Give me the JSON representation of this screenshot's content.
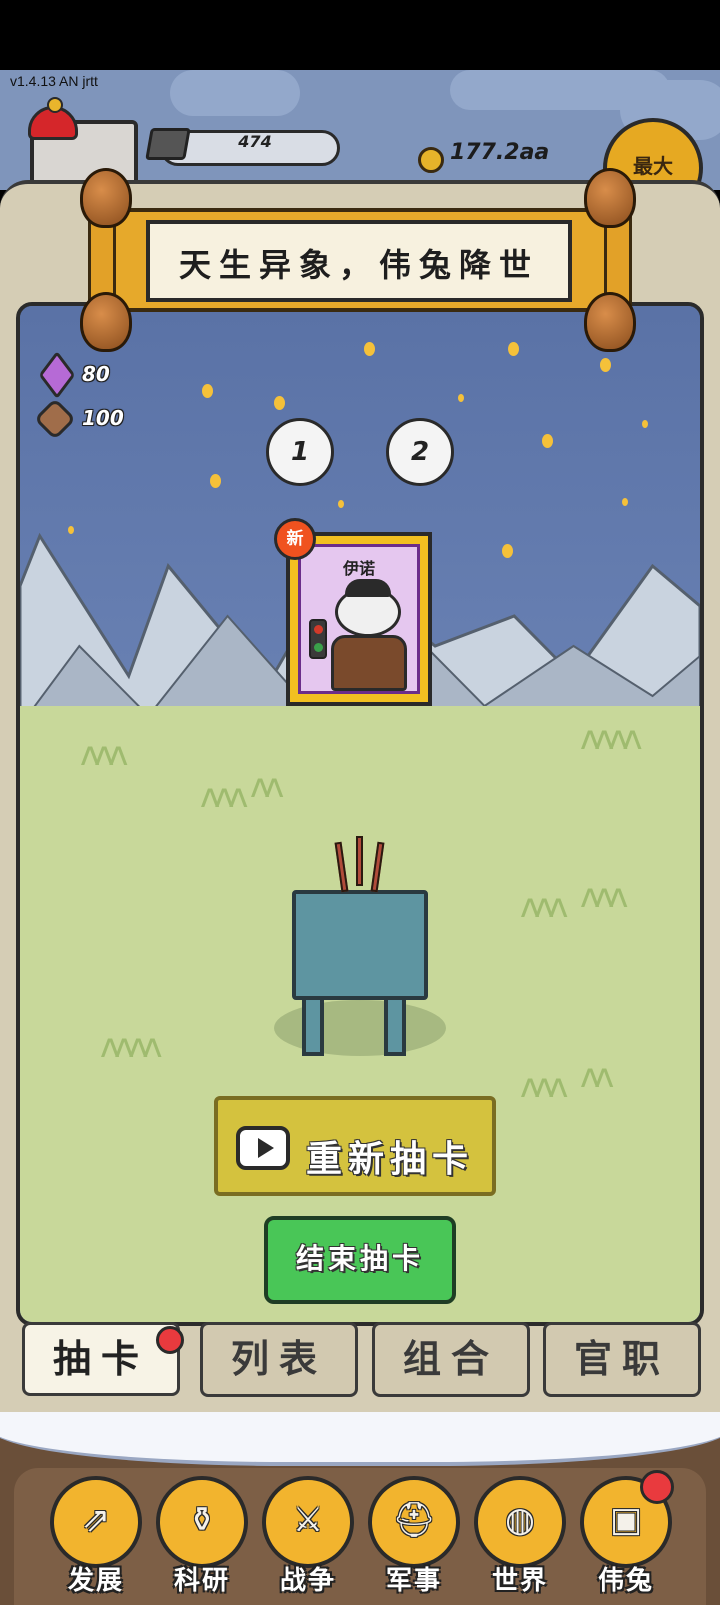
{
  "hud": {
    "version": "v1.4.13 AN jrtt",
    "iron_value": "474",
    "coin_value": "177.2aa",
    "max_label": "最大"
  },
  "banner": {
    "title": "天生异象，伟兔降世"
  },
  "resources": {
    "gems": "80",
    "ore": "100"
  },
  "pages": [
    "1",
    "2"
  ],
  "card": {
    "name": "伊诺",
    "badge": "新"
  },
  "actions": {
    "redraw_label": "重新抽卡",
    "end_label": "结束抽卡"
  },
  "tabs": [
    {
      "label": "抽卡",
      "active": true,
      "notify": true
    },
    {
      "label": "列表",
      "active": false
    },
    {
      "label": "组合",
      "active": false
    },
    {
      "label": "官职",
      "active": false
    }
  ],
  "nav": [
    {
      "label": "发展",
      "icon": "arrow-up-icon"
    },
    {
      "label": "科研",
      "icon": "flask-icon"
    },
    {
      "label": "战争",
      "icon": "crossed-swords-icon"
    },
    {
      "label": "军事",
      "icon": "helmet-icon"
    },
    {
      "label": "世界",
      "icon": "globe-icon"
    },
    {
      "label": "伟兔",
      "icon": "rabbit-portrait-icon",
      "notify": true
    }
  ],
  "colors": {
    "sky": "#5d76a8",
    "meadow": "#c8d89a",
    "accent_gold": "#e6a92b",
    "end_green": "#49c657",
    "notify_red": "#e93a3e"
  }
}
